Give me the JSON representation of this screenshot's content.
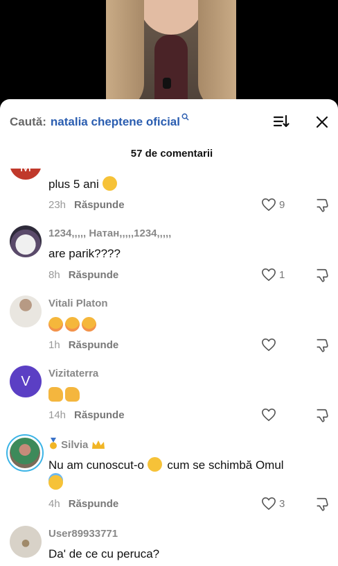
{
  "search": {
    "prefix": "Caută:",
    "term": "natalia cheptene oficial",
    "search_glyph": "search-icon"
  },
  "header": {
    "count_label": "57 de comentarii",
    "sort_icon": "sort-icon",
    "close_icon": "close-icon"
  },
  "colors": {
    "accent": "#2a5db0",
    "avatar_purple": "#5b3fc4",
    "avatar_red": "#c0392b"
  },
  "reply_label": "Răspunde",
  "comments": [
    {
      "avatar_letter": "M",
      "username": "",
      "text": "plus 5 ani",
      "emoji": [
        "thinking-face-emoji"
      ],
      "time": "23h",
      "likes": "9"
    },
    {
      "avatar_letter": "",
      "username": "1234,,,,, Натан,,,,,1234,,,,,",
      "text": "are parik????",
      "emoji": [],
      "time": "8h",
      "likes": "1"
    },
    {
      "avatar_letter": "",
      "username": "Vitali Platon",
      "text": "",
      "emoji": [
        "smiling-face-with-hearts-emoji",
        "smiling-face-with-hearts-emoji",
        "smiling-face-with-hearts-emoji"
      ],
      "time": "1h",
      "likes": ""
    },
    {
      "avatar_letter": "V",
      "username": "Vizitaterra",
      "text": "",
      "emoji": [
        "thumbs-up-emoji",
        "thumbs-up-emoji"
      ],
      "time": "14h",
      "likes": ""
    },
    {
      "avatar_letter": "",
      "username": "Silvia",
      "text": "Nu am cunoscut-o",
      "text_after": "cum se schimbă Omul",
      "emoji": [
        "pensive-face-emoji",
        "smiling-face-with-halo-emoji"
      ],
      "time": "4h",
      "likes": "3"
    },
    {
      "avatar_letter": "",
      "username": "User89933771",
      "text": "Da' de ce cu peruca?",
      "emoji": [],
      "time": "",
      "likes": ""
    }
  ]
}
